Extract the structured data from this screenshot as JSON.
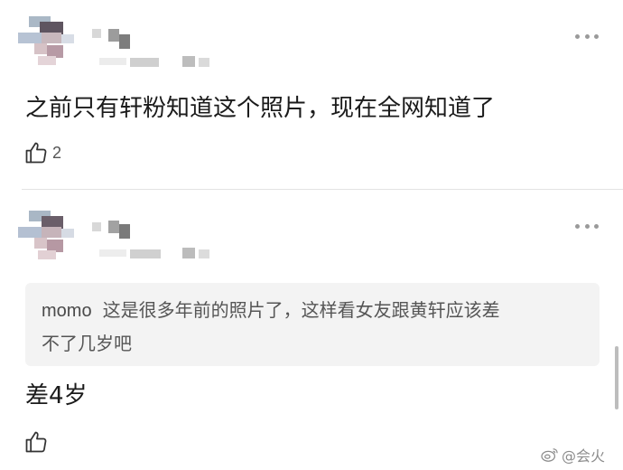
{
  "comments": [
    {
      "text": "之前只有轩粉知道这个照片，现在全网知道了",
      "likes": "2"
    },
    {
      "quote": {
        "author": "momo",
        "line1": "这是很多年前的照片了，这样看女友跟黄轩应该差",
        "line2": "不了几岁吧"
      },
      "text": "差4岁",
      "likes": ""
    }
  ],
  "watermark": "@会火",
  "icons": {
    "more": "more-dots-icon",
    "like": "thumbs-up-icon",
    "weibo": "weibo-logo-icon"
  }
}
